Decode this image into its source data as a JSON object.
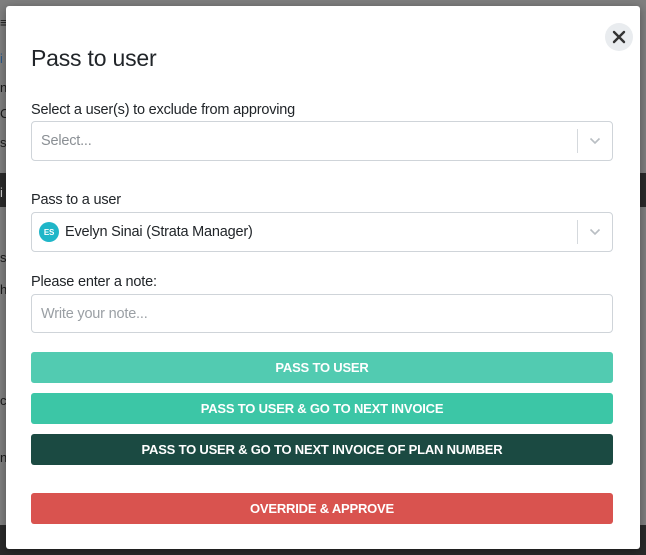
{
  "modal": {
    "title": "Pass to user",
    "exclude_field": {
      "label": "Select a user(s) to exclude from approving",
      "placeholder": "Select..."
    },
    "pass_to_field": {
      "label": "Pass to a user",
      "selected_initials": "ES",
      "selected_value": "Evelyn Sinai (Strata Manager)"
    },
    "note_field": {
      "label": "Please enter a note:",
      "placeholder": "Write your note...",
      "value": ""
    },
    "buttons": {
      "pass_to_user": "PASS TO USER",
      "pass_next_invoice": "PASS TO USER & GO TO NEXT INVOICE",
      "pass_next_invoice_plan": "PASS TO USER & GO TO NEXT INVOICE OF PLAN NUMBER",
      "override_approve": "OVERRIDE & APPROVE"
    }
  },
  "background_fragments": [
    "≡",
    "i",
    "n",
    "C",
    "s",
    "i",
    "s",
    "h",
    "c",
    "n"
  ],
  "colors": {
    "button_primary_light": "#52cbb1",
    "button_primary": "#3cc6a6",
    "button_dark": "#1b4a42",
    "button_danger": "#d9534f",
    "avatar": "#1fb6c8"
  }
}
